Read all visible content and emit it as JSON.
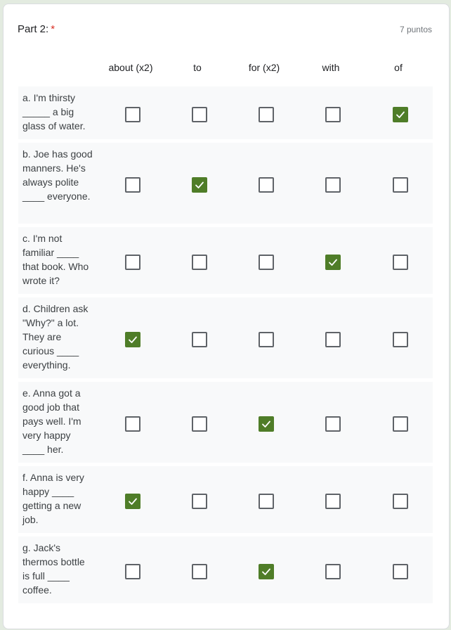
{
  "question": {
    "title": "Part 2:",
    "required_marker": "*",
    "points": "7 puntos"
  },
  "columns": [
    "about (x2)",
    "to",
    "for (x2)",
    "with",
    "of"
  ],
  "rows": [
    {
      "label": "a. I'm thirsty _____ a big glass of water.",
      "checked": [
        false,
        false,
        false,
        false,
        true
      ]
    },
    {
      "label": "b. Joe has good manners. He's always polite ____ everyone.",
      "checked": [
        false,
        true,
        false,
        false,
        false
      ]
    },
    {
      "label": "c. I'm not familiar ____ that book. Who wrote it?",
      "checked": [
        false,
        false,
        false,
        true,
        false
      ]
    },
    {
      "label": "d. Children ask \"Why?\" a lot. They are curious ____ everything.",
      "checked": [
        true,
        false,
        false,
        false,
        false
      ]
    },
    {
      "label": "e. Anna got a good job that pays well. I'm very happy ____ her.",
      "checked": [
        false,
        false,
        true,
        false,
        false
      ]
    },
    {
      "label": "f. Anna is very happy ____ getting a new job.",
      "checked": [
        true,
        false,
        false,
        false,
        false
      ]
    },
    {
      "label": "g. Jack's thermos bottle is full ____ coffee.",
      "checked": [
        false,
        false,
        true,
        false,
        false
      ]
    }
  ],
  "colors": {
    "accent": "#4f7d28",
    "required": "#d93025",
    "row_bg": "#f8f9fa",
    "page_bg": "#e3ebe0"
  }
}
